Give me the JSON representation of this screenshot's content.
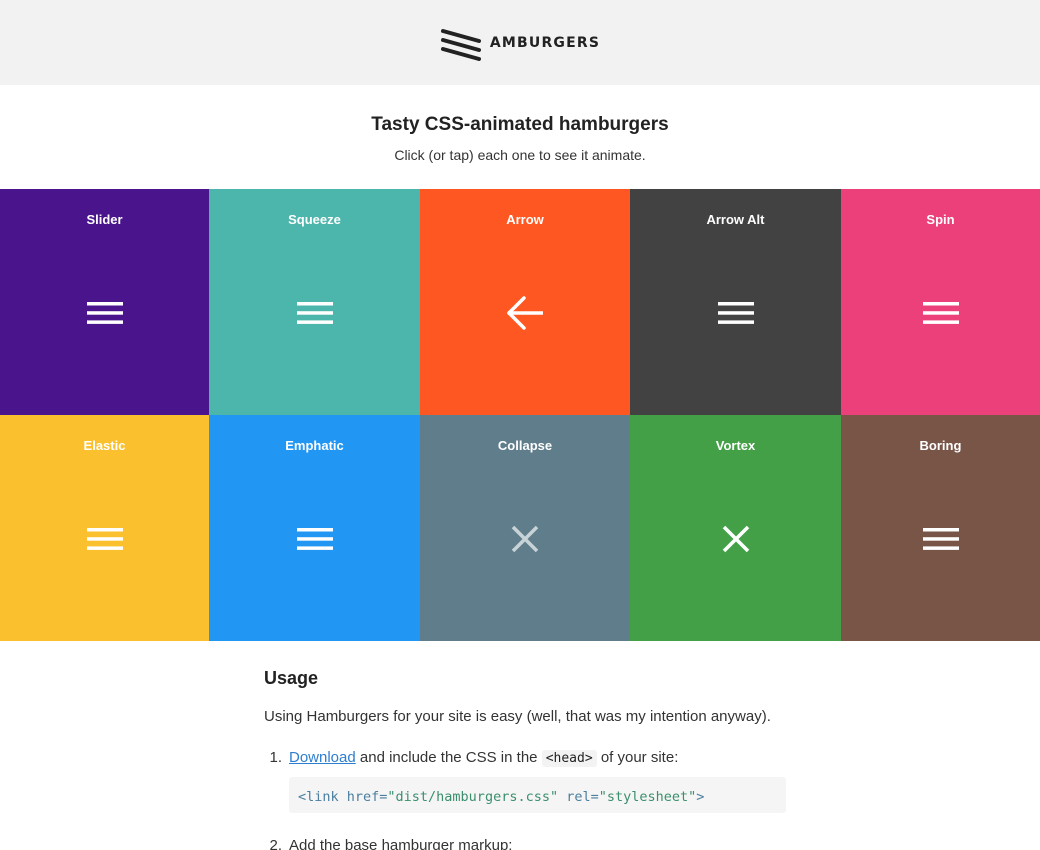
{
  "header": {
    "logo_text": "AMBURGERS",
    "logo_icon": "three-diagonal-bars-icon"
  },
  "intro": {
    "title": "Tasty CSS-animated hamburgers",
    "subtitle": "Click (or tap) each one to see it animate."
  },
  "tiles": [
    {
      "name": "Slider",
      "color": "#4a148c",
      "icon": "hamburger-icon"
    },
    {
      "name": "Squeeze",
      "color": "#4db6ac",
      "icon": "hamburger-icon"
    },
    {
      "name": "Arrow",
      "color": "#ff5722",
      "icon": "arrow-left-icon"
    },
    {
      "name": "Arrow Alt",
      "color": "#424242",
      "icon": "hamburger-icon"
    },
    {
      "name": "Spin",
      "color": "#ec407a",
      "icon": "hamburger-icon"
    },
    {
      "name": "Elastic",
      "color": "#fbc02d",
      "icon": "hamburger-icon"
    },
    {
      "name": "Emphatic",
      "color": "#2196f3",
      "icon": "hamburger-icon"
    },
    {
      "name": "Collapse",
      "color": "#607d8b",
      "icon": "close-icon"
    },
    {
      "name": "Vortex",
      "color": "#43a047",
      "icon": "close-icon"
    },
    {
      "name": "Boring",
      "color": "#795548",
      "icon": "hamburger-icon"
    }
  ],
  "usage": {
    "heading": "Usage",
    "intro": "Using Hamburgers for your site is easy (well, that was my intention anyway).",
    "steps": [
      {
        "number": "1.",
        "link": "Download",
        "text_a": " and include the CSS in the ",
        "code": "<head>",
        "text_b": " of your site:",
        "code_block_tag": "<link href=",
        "code_block_href": "\"dist/hamburgers.css\"",
        "code_block_rel": " rel=",
        "code_block_rel_value": "\"stylesheet\"",
        "code_block_end": ">"
      },
      {
        "number": "2.",
        "text": "Add the base hamburger markup:"
      }
    ]
  }
}
